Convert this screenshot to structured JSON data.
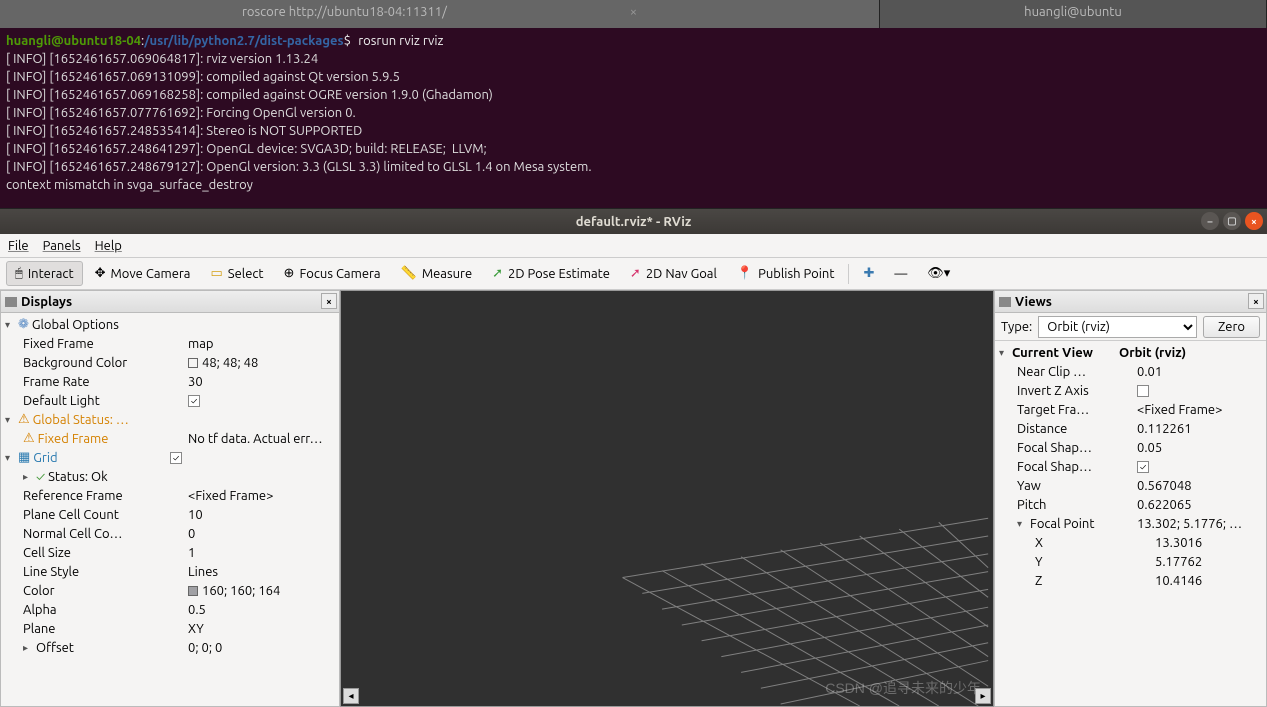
{
  "tabs": {
    "left": "roscore http://ubuntu18-04:11311/",
    "right": "huangli@ubuntu"
  },
  "terminal": {
    "user": "huangli@ubuntu18-04",
    "path": "/usr/lib/python2.7/dist-packages",
    "prompt_sym": "$",
    "command": "rosrun rviz rviz",
    "lines": [
      "[ INFO] [1652461657.069064817]: rviz version 1.13.24",
      "[ INFO] [1652461657.069131099]: compiled against Qt version 5.9.5",
      "[ INFO] [1652461657.069168258]: compiled against OGRE version 1.9.0 (Ghadamon)",
      "[ INFO] [1652461657.077761692]: Forcing OpenGl version 0.",
      "[ INFO] [1652461657.248535414]: Stereo is NOT SUPPORTED",
      "[ INFO] [1652461657.248641297]: OpenGL device: SVGA3D; build: RELEASE;  LLVM;",
      "[ INFO] [1652461657.248679127]: OpenGl version: 3.3 (GLSL 3.3) limited to GLSL 1.4 on Mesa system.",
      "context mismatch in svga_surface_destroy"
    ]
  },
  "rviz": {
    "title": "default.rviz* - RViz",
    "menu": {
      "file": "File",
      "panels": "Panels",
      "help": "Help"
    },
    "toolbar": {
      "interact": "Interact",
      "move_camera": "Move Camera",
      "select": "Select",
      "focus_camera": "Focus Camera",
      "measure": "Measure",
      "pose_estimate": "2D Pose Estimate",
      "nav_goal": "2D Nav Goal",
      "publish_point": "Publish Point"
    },
    "displays": {
      "title": "Displays",
      "global_options": {
        "label": "Global Options",
        "fixed_frame": {
          "label": "Fixed Frame",
          "value": "map"
        },
        "bg_color": {
          "label": "Background Color",
          "value": "48; 48; 48",
          "hex": "#303030"
        },
        "frame_rate": {
          "label": "Frame Rate",
          "value": "30"
        },
        "default_light": {
          "label": "Default Light",
          "checked": true
        }
      },
      "global_status": {
        "label": "Global Status: …",
        "fixed_frame": {
          "label": "Fixed Frame",
          "value": "No tf data.  Actual err…"
        }
      },
      "grid": {
        "label": "Grid",
        "status": {
          "label": "Status: Ok"
        },
        "reference_frame": {
          "label": "Reference Frame",
          "value": "<Fixed Frame>"
        },
        "plane_cell_count": {
          "label": "Plane Cell Count",
          "value": "10"
        },
        "normal_cell_count": {
          "label": "Normal Cell Co…",
          "value": "0"
        },
        "cell_size": {
          "label": "Cell Size",
          "value": "1"
        },
        "line_style": {
          "label": "Line Style",
          "value": "Lines"
        },
        "color": {
          "label": "Color",
          "value": "160; 160; 164",
          "hex": "#a0a0a4"
        },
        "alpha": {
          "label": "Alpha",
          "value": "0.5"
        },
        "plane": {
          "label": "Plane",
          "value": "XY"
        },
        "offset": {
          "label": "Offset",
          "value": "0; 0; 0"
        }
      }
    },
    "views": {
      "title": "Views",
      "type_label": "Type:",
      "type_value": "Orbit (rviz)",
      "zero": "Zero",
      "current": {
        "label": "Current View",
        "value": "Orbit (rviz)",
        "near_clip": {
          "label": "Near Clip …",
          "value": "0.01"
        },
        "invert_z": {
          "label": "Invert Z Axis",
          "checked": false
        },
        "target_frame": {
          "label": "Target Fra…",
          "value": "<Fixed Frame>"
        },
        "distance": {
          "label": "Distance",
          "value": "0.112261"
        },
        "focal_shape1": {
          "label": "Focal Shap…",
          "value": "0.05"
        },
        "focal_shape2": {
          "label": "Focal Shap…",
          "checked": true
        },
        "yaw": {
          "label": "Yaw",
          "value": "0.567048"
        },
        "pitch": {
          "label": "Pitch",
          "value": "0.622065"
        },
        "focal_point": {
          "label": "Focal Point",
          "value": "13.302; 5.1776; …",
          "x": {
            "label": "X",
            "value": "13.3016"
          },
          "y": {
            "label": "Y",
            "value": "5.17762"
          },
          "z": {
            "label": "Z",
            "value": "10.4146"
          }
        }
      }
    }
  },
  "watermark": "CSDN @追寻未来的少年"
}
